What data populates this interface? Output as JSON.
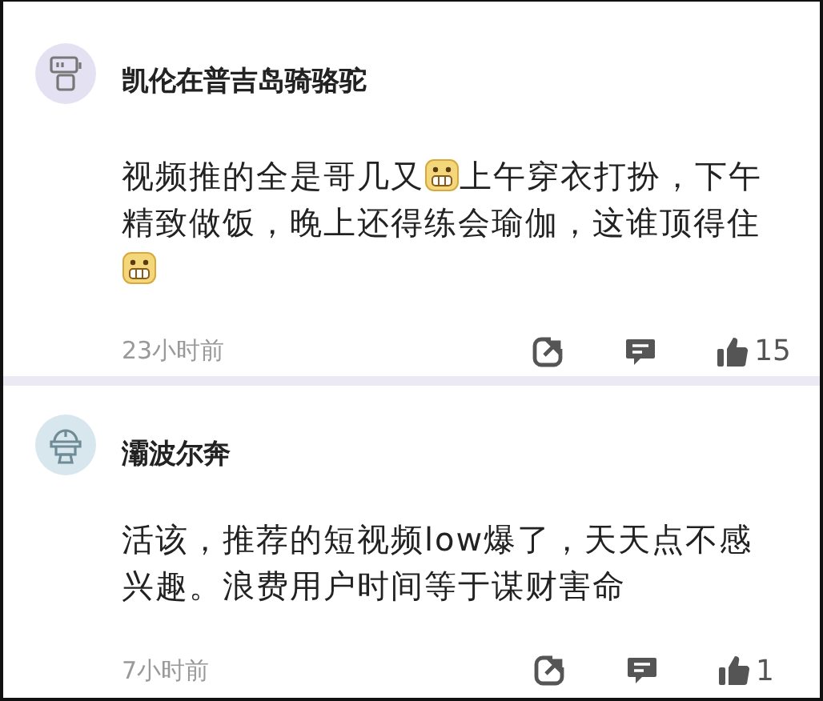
{
  "comments": [
    {
      "avatar": {
        "kind": "robot"
      },
      "name": "凯伦在普吉岛骑骆驼",
      "body": [
        {
          "kind": "text",
          "text": "视频推的全是哥几又"
        },
        {
          "kind": "sticker"
        },
        {
          "kind": "text",
          "text": "上午穿衣打扮，下午精致做饭，晚上还得练会瑜伽，这谁顶得住"
        },
        {
          "kind": "sticker"
        }
      ],
      "time": "23小时前",
      "likes": "15"
    },
    {
      "avatar": {
        "kind": "helmet"
      },
      "name": "灞波尔奔",
      "body": [
        {
          "kind": "text",
          "text": "活该，推荐的短视频low爆了，天天点不感兴趣。浪费用户时间等于谋财害命"
        }
      ],
      "time": "7小时前",
      "likes": "1"
    }
  ]
}
